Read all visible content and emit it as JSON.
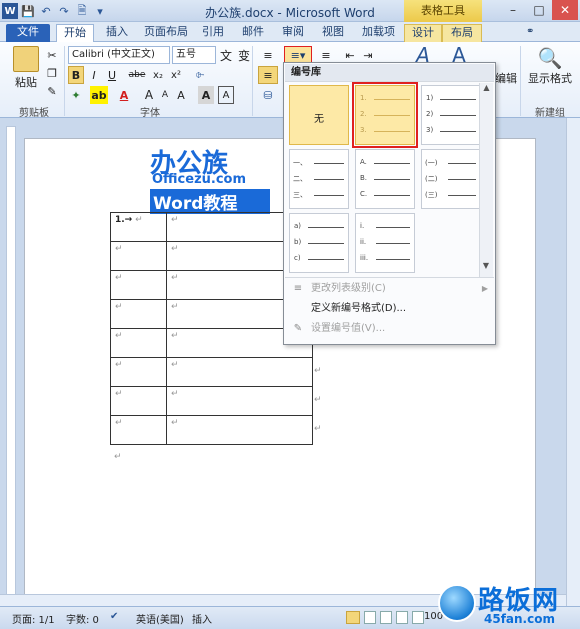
{
  "app": {
    "title": "办公族.docx - Microsoft Word",
    "contextual_group": "表格工具"
  },
  "tabs": [
    {
      "label": "文件"
    },
    {
      "label": "开始"
    },
    {
      "label": "插入"
    },
    {
      "label": "页面布局"
    },
    {
      "label": "引用"
    },
    {
      "label": "邮件"
    },
    {
      "label": "审阅"
    },
    {
      "label": "视图"
    },
    {
      "label": "加载项"
    },
    {
      "label": "设计"
    },
    {
      "label": "布局"
    }
  ],
  "ribbon": {
    "paste_label": "粘贴",
    "clipboard_group": "剪贴板",
    "font_group": "字体",
    "font_name": "Calibri (中文正文)",
    "font_size": "五号",
    "editing_label": "编辑",
    "show_format_label": "显示格式",
    "new_group": "新建组",
    "font_size_glyph": "A A",
    "wen": "文",
    "wen_sub": "变",
    "format_buttons": {
      "bold": "B",
      "italic": "I",
      "underline": "U",
      "strike": "abe",
      "subscript": "x₂",
      "superscript": "x²",
      "fontcolor": "A",
      "grow": "A",
      "shrink": "A",
      "clear": "A",
      "charborder": "A",
      "styles_a": "A"
    }
  },
  "document": {
    "logo_cn": "办公族",
    "logo_en": "Officezu.com",
    "logo_word": "Word教程",
    "first_cell": "1.→",
    "table_rows": 8
  },
  "numbering_dropdown": {
    "header": "编号库",
    "none_label": "无",
    "tiles": [
      {
        "lines": [
          "1.",
          "2.",
          "3."
        ]
      },
      {
        "lines": [
          "1)",
          "2)",
          "3)"
        ]
      },
      {
        "lines": [
          "一、",
          "二、",
          "三、"
        ]
      },
      {
        "lines": [
          "A.",
          "B.",
          "C."
        ]
      },
      {
        "lines": [
          "(一)",
          "(二)",
          "(三)"
        ]
      },
      {
        "lines": [
          "a)",
          "b)",
          "c)"
        ]
      },
      {
        "lines": [
          "i.",
          "ii.",
          "iii."
        ]
      }
    ],
    "menu": [
      {
        "label": "更改列表级别(C)",
        "enabled": false
      },
      {
        "label": "定义新编号格式(D)...",
        "enabled": true
      },
      {
        "label": "设置编号值(V)...",
        "enabled": false
      }
    ]
  },
  "status_bar": {
    "page": "页面: 1/1",
    "words": "字数: 0",
    "language": "英语(美国)",
    "mode": "插入",
    "zoom": "100"
  },
  "watermark": {
    "cn": "路饭网",
    "url": "45fan.com"
  }
}
